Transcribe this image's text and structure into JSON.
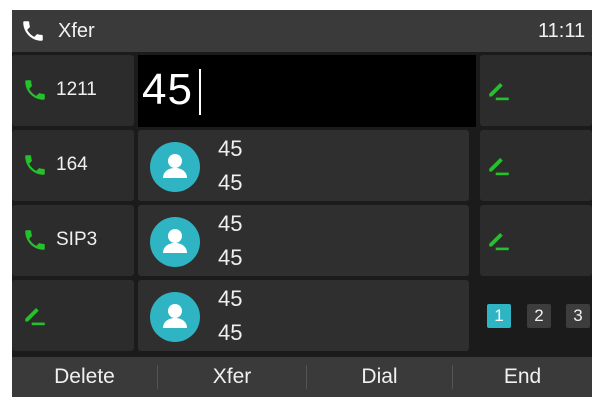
{
  "header": {
    "title": "Xfer",
    "time": "11:11"
  },
  "left_keys": [
    {
      "label": "1211",
      "icon": "phone-icon"
    },
    {
      "label": "164",
      "icon": "phone-icon"
    },
    {
      "label": "SIP3",
      "icon": "phone-icon"
    },
    {
      "label": "",
      "icon": "pencil-icon"
    }
  ],
  "input": {
    "value": "45"
  },
  "results": [
    {
      "name": "45",
      "number": "45"
    },
    {
      "name": "45",
      "number": "45"
    },
    {
      "name": "45",
      "number": "45"
    }
  ],
  "right_keys": [
    {
      "icon": "pencil-icon"
    },
    {
      "icon": "pencil-icon"
    },
    {
      "icon": "pencil-icon"
    }
  ],
  "pages": [
    "1",
    "2",
    "3"
  ],
  "softkeys": [
    "Delete",
    "Xfer",
    "Dial",
    "End"
  ],
  "colors": {
    "accent_green": "#25c12c",
    "avatar_teal": "#2fb4c3",
    "page_active": "#2fb4c3"
  }
}
